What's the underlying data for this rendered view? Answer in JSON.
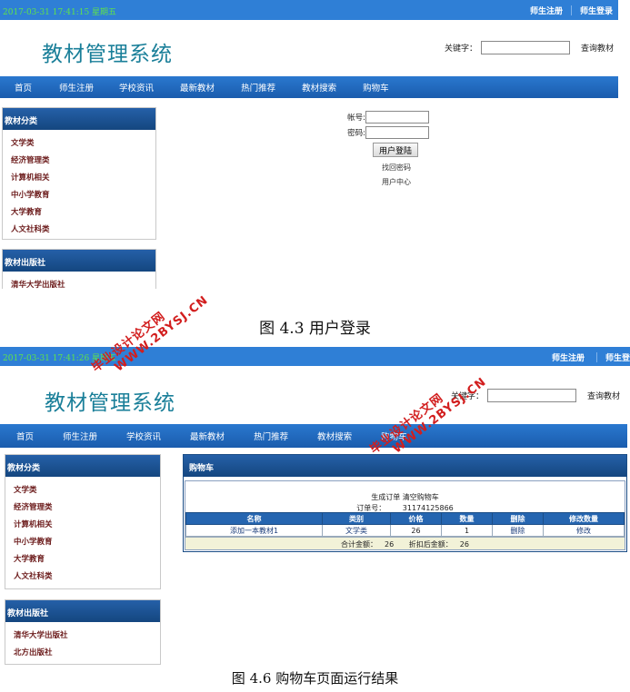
{
  "screen1": {
    "datetime": "2017-03-31 17:41:15 星期五",
    "top_links": [
      "师生注册",
      "师生登录"
    ],
    "title": "教材管理系统",
    "search_label": "关键字：",
    "search_value": "",
    "search_button": "查询教材",
    "nav": [
      "首页",
      "师生注册",
      "学校资讯",
      "最新教材",
      "热门推荐",
      "教材搜索",
      "购物车"
    ],
    "category_panel": {
      "title": "教材分类",
      "items": [
        "文学类",
        "经济管理类",
        "计算机相关",
        "中小学教育",
        "大学教育",
        "人文社科类"
      ]
    },
    "publisher_panel": {
      "title": "教材出版社",
      "items": [
        "清华大学出版社"
      ]
    },
    "login": {
      "account_label": "帐号:",
      "password_label": "密码:",
      "submit": "用户登陆",
      "find_password": "找回密码",
      "user_center": "用户中心"
    }
  },
  "caption1": "图 4.3 用户登录",
  "screen2": {
    "datetime": "2017-03-31 17:41:26 星期五",
    "top_links": [
      "师生注册",
      "师生登"
    ],
    "title": "教材管理系统",
    "search_label": "关键字：",
    "search_value": "",
    "search_button": "查询教材",
    "nav": [
      "首页",
      "师生注册",
      "学校资讯",
      "最新教材",
      "热门推荐",
      "教材搜索",
      "购物车"
    ],
    "category_panel": {
      "title": "教材分类",
      "items": [
        "文学类",
        "经济管理类",
        "计算机相关",
        "中小学教育",
        "大学教育",
        "人文社科类"
      ]
    },
    "publisher_panel": {
      "title": "教材出版社",
      "items": [
        "清华大学出版社",
        "北方出版社"
      ]
    },
    "cart": {
      "title": "购物车",
      "generate_order": "生成订单",
      "clear_cart": "清空购物车",
      "order_label": "订单号：",
      "order_no": "31174125866",
      "columns": [
        "名称",
        "类别",
        "价格",
        "数量",
        "删除",
        "修改数量"
      ],
      "rows": [
        {
          "name": "添加一本教材1",
          "category": "文学类",
          "price": "26",
          "qty": "1",
          "delete": "删除",
          "modify": "修改"
        }
      ],
      "total_label": "合计金额：",
      "total": "26",
      "discount_label": "折扣后金额：",
      "discount_total": "26"
    }
  },
  "caption2": "图 4.6 购物车页面运行结果",
  "watermarks": {
    "cn": "毕业设计论文网",
    "url": "WWW.2BYSJ.CN"
  },
  "colors": {
    "topbar": "#2f7fd6",
    "datetime": "#5fe34a",
    "title": "#1a7f99",
    "watermark": "#d21e1e"
  }
}
